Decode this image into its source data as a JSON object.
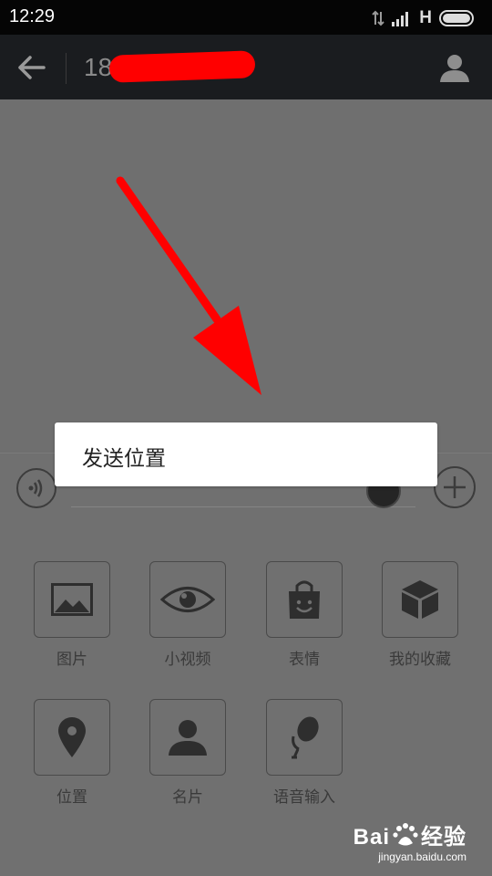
{
  "status_bar": {
    "time": "12:29",
    "network_type": "H"
  },
  "header": {
    "contact_number": "18"
  },
  "popup": {
    "items": [
      "发送位置"
    ]
  },
  "panel": {
    "items": [
      {
        "label": "图片",
        "icon": "image-icon"
      },
      {
        "label": "小视频",
        "icon": "eye-icon"
      },
      {
        "label": "表情",
        "icon": "sticker-bag-icon"
      },
      {
        "label": "我的收藏",
        "icon": "cube-icon"
      },
      {
        "label": "位置",
        "icon": "location-pin-icon"
      },
      {
        "label": "名片",
        "icon": "person-icon"
      },
      {
        "label": "语音输入",
        "icon": "microphone-icon"
      }
    ]
  },
  "watermark": {
    "brand": "Bai",
    "brand_suffix": "经验",
    "site": "jingyan.baidu.com"
  },
  "colors": {
    "annotation_arrow": "#ff0000",
    "header_bg": "#1a1c1f",
    "dim_overlay": "#6f6f6f"
  }
}
